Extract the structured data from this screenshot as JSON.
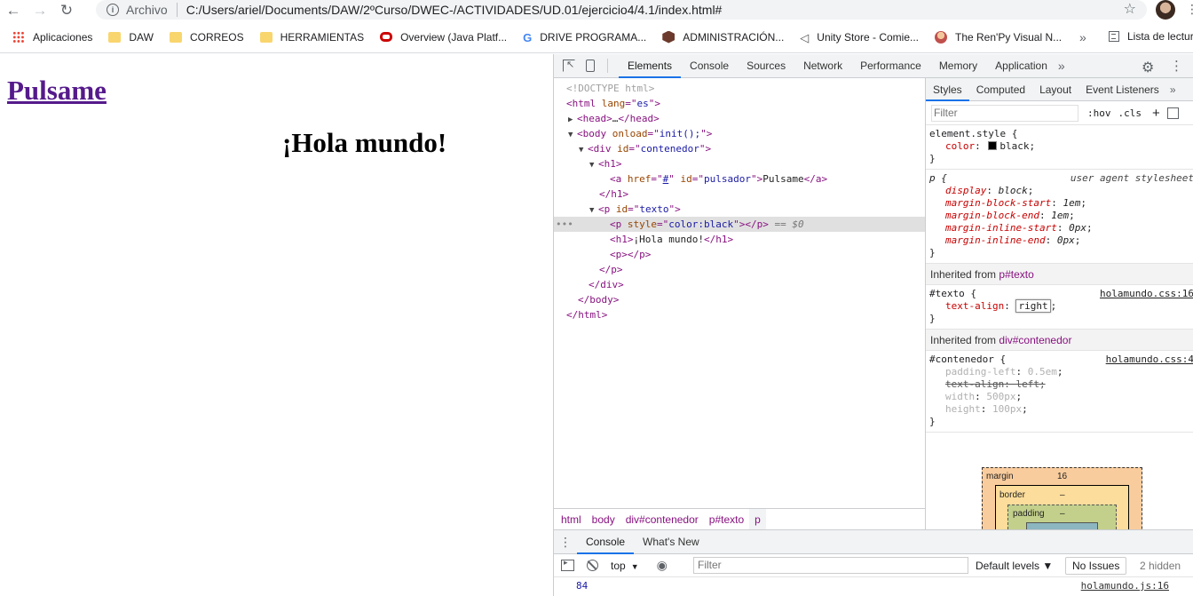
{
  "browser": {
    "address": {
      "scheme_label": "Archivo",
      "url": "C:/Users/ariel/Documents/DAW/2ºCurso/DWEC-/ACTIVIDADES/UD.01/ejercicio4/4.1/index.html#"
    },
    "bookmarks": [
      {
        "label": "Aplicaciones",
        "icon": "apps-icon"
      },
      {
        "label": "DAW",
        "icon": "folder-icon"
      },
      {
        "label": "CORREOS",
        "icon": "folder-icon"
      },
      {
        "label": "HERRAMIENTAS",
        "icon": "folder-icon"
      },
      {
        "label": "Overview (Java Platf...",
        "icon": "oracle-icon"
      },
      {
        "label": "DRIVE PROGRAMA...",
        "icon": "google-icon"
      },
      {
        "label": "ADMINISTRACIÓN...",
        "icon": "hexagon-icon"
      },
      {
        "label": "Unity Store - Comie...",
        "icon": "unity-icon"
      },
      {
        "label": "The Ren'Py Visual N...",
        "icon": "renpy-icon"
      }
    ],
    "reading_list": "Lista de lectura"
  },
  "page": {
    "link_text": "Pulsame",
    "heading_text": "¡Hola mundo!"
  },
  "devtools": {
    "tabs": [
      "Elements",
      "Console",
      "Sources",
      "Network",
      "Performance",
      "Memory",
      "Application"
    ],
    "active_tab": "Elements",
    "dom": {
      "doctype": "<!DOCTYPE html>",
      "html_lang": "es",
      "body_onload": "init();",
      "div_id": "contenedor",
      "a_href": "#",
      "a_id": "pulsador",
      "a_text": "Pulsame",
      "p_id": "texto",
      "p_style": "color:black",
      "selected_marker": "== $0",
      "h1_text": "¡Hola mundo!"
    },
    "breadcrumbs": [
      "html",
      "body",
      "div#contenedor",
      "p#texto",
      "p"
    ],
    "styles": {
      "tabs": [
        "Styles",
        "Computed",
        "Layout",
        "Event Listeners"
      ],
      "filter_placeholder": "Filter",
      "hov": ":hov",
      "cls": ".cls",
      "element_style": {
        "selector": "element.style {",
        "prop": "color",
        "value": "black"
      },
      "ua_rule": {
        "selector": "p {",
        "source": "user agent stylesheet",
        "props": [
          {
            "name": "display",
            "value": "block"
          },
          {
            "name": "margin-block-start",
            "value": "1em"
          },
          {
            "name": "margin-block-end",
            "value": "1em"
          },
          {
            "name": "margin-inline-start",
            "value": "0px"
          },
          {
            "name": "margin-inline-end",
            "value": "0px"
          }
        ]
      },
      "inherited_1": {
        "label": "Inherited from",
        "selector_name": "p#texto"
      },
      "texto_rule": {
        "selector": "#texto {",
        "source": "holamundo.css:16",
        "prop": "text-align",
        "value": "right"
      },
      "inherited_2": {
        "label": "Inherited from",
        "selector_name": "div#contenedor"
      },
      "contenedor_rule": {
        "selector": "#contenedor {",
        "source": "holamundo.css:4",
        "props": [
          {
            "name": "padding-left",
            "value": "0.5em"
          },
          {
            "name": "text-align",
            "value": "left"
          },
          {
            "name": "width",
            "value": "500px"
          },
          {
            "name": "height",
            "value": "100px"
          }
        ]
      },
      "box_model": {
        "margin_label": "margin",
        "margin_value": "16",
        "border_label": "border",
        "border_value": "–",
        "padding_label": "padding",
        "padding_value": "–"
      }
    },
    "drawer": {
      "tabs": [
        "Console",
        "What's New"
      ],
      "context": "top",
      "filter_placeholder": "Filter",
      "levels": "Default levels",
      "issues_button": "No Issues",
      "hidden": "2 hidden",
      "log": {
        "value": "84",
        "source": "holamundo.js:16"
      }
    }
  }
}
